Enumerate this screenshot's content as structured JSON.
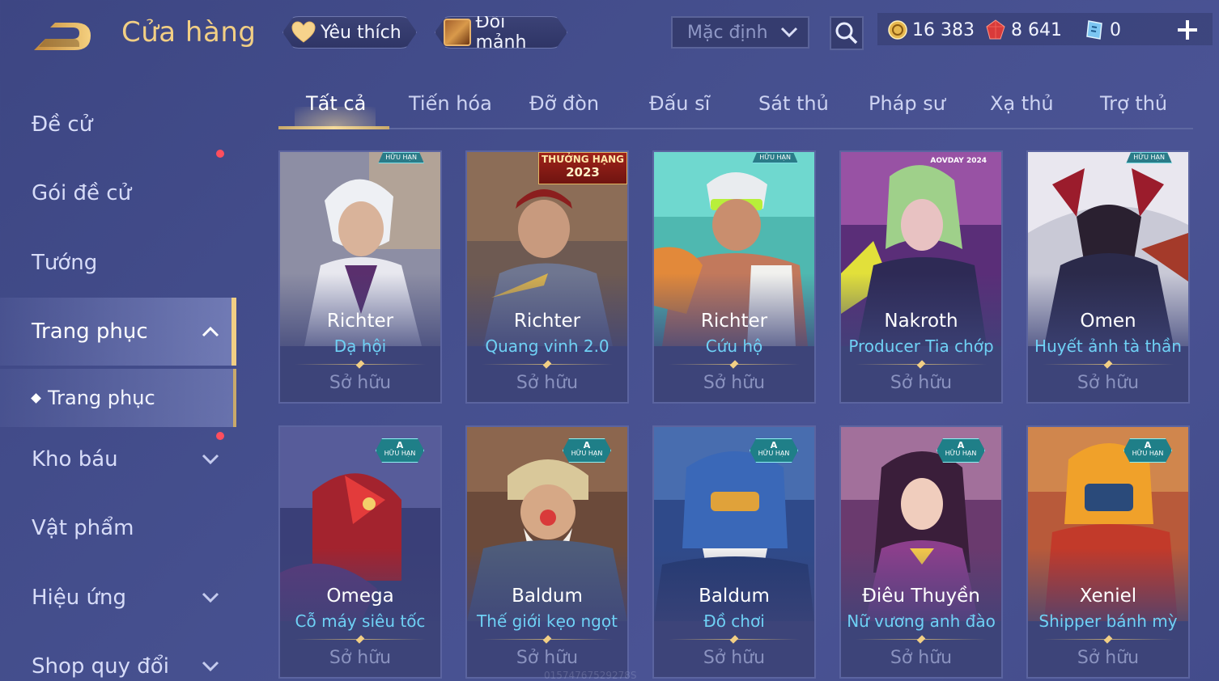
{
  "header": {
    "title": "Cửa hàng",
    "favorite_label": "Yêu thích",
    "exchange_label": "Đổi mảnh",
    "sort_value": "Mặc định",
    "currencies": {
      "gold": "16 383",
      "ruby": "8 641",
      "voucher": "0"
    }
  },
  "sidebar": {
    "items": [
      {
        "label": "Đề cử"
      },
      {
        "label": "Gói đề cử"
      },
      {
        "label": "Tướng"
      },
      {
        "label": "Trang phục"
      },
      {
        "label": "Trang phục"
      },
      {
        "label": "Kho báu"
      },
      {
        "label": "Vật phẩm"
      },
      {
        "label": "Hiệu ứng"
      },
      {
        "label": "Shop quy đổi"
      }
    ]
  },
  "tabs": [
    {
      "label": "Tất cả"
    },
    {
      "label": "Tiến hóa"
    },
    {
      "label": "Đỡ đòn"
    },
    {
      "label": "Đấu sĩ"
    },
    {
      "label": "Sát thủ"
    },
    {
      "label": "Pháp sư"
    },
    {
      "label": "Xạ thủ"
    },
    {
      "label": "Trợ thủ"
    }
  ],
  "cards": [
    {
      "hero": "Richter",
      "skin": "Dạ hội",
      "status": "Sở hữu",
      "badge": "HỮU HẠN"
    },
    {
      "hero": "Richter",
      "skin": "Quang vinh 2.0",
      "status": "Sở hữu",
      "rank": "THƯỞNG HẠNG",
      "year": "2023"
    },
    {
      "hero": "Richter",
      "skin": "Cứu hộ",
      "status": "Sở hữu",
      "badge": "HỮU HẠN"
    },
    {
      "hero": "Nakroth",
      "skin": "Producer Tia chớp",
      "status": "Sở hữu",
      "logo": "AOVDAY 2024"
    },
    {
      "hero": "Omen",
      "skin": "Huyết ảnh tà thần",
      "status": "Sở hữu",
      "badge": "HỮU HẠN"
    },
    {
      "hero": "Omega",
      "skin": "Cỗ máy siêu tốc",
      "status": "Sở hữu",
      "grade": "A",
      "badge": "HỮU HẠN"
    },
    {
      "hero": "Baldum",
      "skin": "Thế giới kẹo ngọt",
      "status": "Sở hữu",
      "grade": "A",
      "badge": "HỮU HẠN"
    },
    {
      "hero": "Baldum",
      "skin": "Đồ chơi",
      "status": "Sở hữu",
      "grade": "A",
      "badge": "HỮU HẠN"
    },
    {
      "hero": "Điêu Thuyền",
      "skin": "Nữ vương anh đào",
      "status": "Sở hữu",
      "grade": "A",
      "badge": "HỮU HẠN"
    },
    {
      "hero": "Xeniel",
      "skin": "Shipper bánh mỳ",
      "status": "Sở hữu",
      "grade": "A",
      "badge": "HỮU HẠN"
    }
  ],
  "watermark": "01574767529278S",
  "colors": {
    "accent_gold": "#f2cf84",
    "skin_name": "#6fd1f5",
    "notification_dot": "#ff4e5e",
    "background": "#444d8c"
  },
  "icons": [
    "back-icon",
    "heart-icon",
    "chest-icon",
    "chevron-down-icon",
    "search-icon",
    "gold-coin-icon",
    "ruby-icon",
    "voucher-icon",
    "plus-icon"
  ]
}
